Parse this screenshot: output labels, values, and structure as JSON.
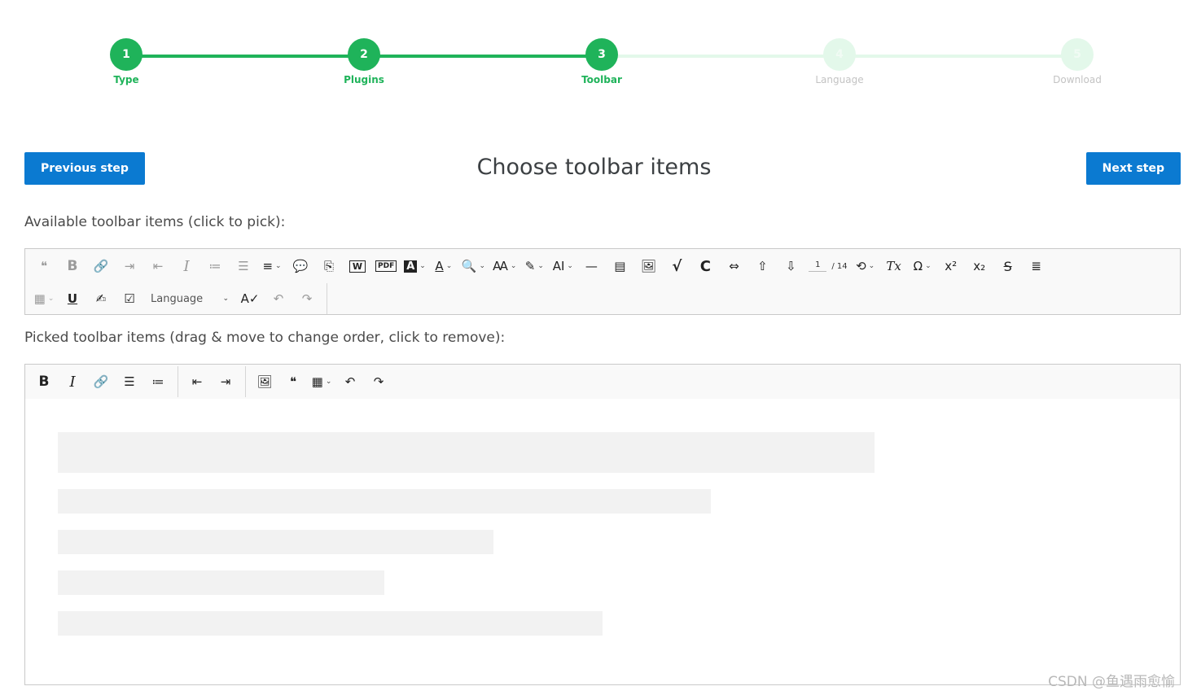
{
  "stepper": {
    "steps": [
      {
        "number": "1",
        "label": "Type",
        "state": "done"
      },
      {
        "number": "2",
        "label": "Plugins",
        "state": "done"
      },
      {
        "number": "3",
        "label": "Toolbar",
        "state": "active"
      },
      {
        "number": "4",
        "label": "Language",
        "state": "pending"
      },
      {
        "number": "5",
        "label": "Download",
        "state": "pending"
      }
    ],
    "colors": {
      "active": "#1fb35a",
      "pending": "#e3f8ea",
      "pending_text": "#c3c3c3"
    }
  },
  "header": {
    "prev_label": "Previous step",
    "title": "Choose toolbar items",
    "next_label": "Next step",
    "button_color": "#0b7ad1"
  },
  "available": {
    "label": "Available toolbar items (click to pick):",
    "items": [
      {
        "name": "block-quote",
        "glyph": "❝",
        "dis": true
      },
      {
        "name": "bold",
        "glyph": "B",
        "dis": true
      },
      {
        "name": "link",
        "glyph": "🔗",
        "dis": true
      },
      {
        "name": "indent",
        "glyph": "⇥",
        "dis": true
      },
      {
        "name": "outdent",
        "glyph": "⇤",
        "dis": true
      },
      {
        "name": "italic",
        "glyph": "I",
        "dis": true
      },
      {
        "name": "numbered-list",
        "glyph": "≔",
        "dis": true
      },
      {
        "name": "bulleted-list",
        "glyph": "☰",
        "dis": true
      },
      {
        "name": "alignment",
        "glyph": "≡",
        "dd": true
      },
      {
        "name": "comment",
        "glyph": "💬"
      },
      {
        "name": "export-html",
        "glyph": "⎘"
      },
      {
        "name": "export-word",
        "glyph": "W"
      },
      {
        "name": "export-pdf",
        "glyph": "PDF"
      },
      {
        "name": "font-background-color",
        "glyph": "A",
        "dd": true
      },
      {
        "name": "font-color",
        "glyph": "A",
        "dd": true
      },
      {
        "name": "find-replace",
        "glyph": "🔍",
        "dd": true
      },
      {
        "name": "font-family",
        "glyph": "Ꜳ",
        "dd": true
      },
      {
        "name": "highlight",
        "glyph": "✎",
        "dd": true
      },
      {
        "name": "font-size",
        "glyph": "AI",
        "dd": true
      },
      {
        "name": "horizontal-line",
        "glyph": "—"
      },
      {
        "name": "html-embed",
        "glyph": "▤"
      },
      {
        "name": "image",
        "glyph": "🖼"
      },
      {
        "name": "math",
        "glyph": "√"
      },
      {
        "name": "code",
        "glyph": "C"
      },
      {
        "name": "page-break",
        "glyph": "⇔"
      },
      {
        "name": "previous-page",
        "glyph": "⇧"
      },
      {
        "name": "next-page",
        "glyph": "⇩"
      },
      {
        "name": "history",
        "glyph": "⟲",
        "dd": true
      },
      {
        "name": "remove-format",
        "glyph": "Tx"
      },
      {
        "name": "special-characters",
        "glyph": "Ω",
        "dd": true
      },
      {
        "name": "superscript",
        "glyph": "x²"
      },
      {
        "name": "subscript",
        "glyph": "x₂"
      },
      {
        "name": "strikethrough",
        "glyph": "S"
      },
      {
        "name": "restricted-editing",
        "glyph": "≣"
      }
    ],
    "page_current": "1",
    "page_total": "/ 14",
    "row2": [
      {
        "name": "table",
        "glyph": "▦",
        "dd": true,
        "dis": true
      },
      {
        "name": "underline",
        "glyph": "U"
      },
      {
        "name": "text-part-language",
        "glyph": "✍"
      },
      {
        "name": "todo-list",
        "glyph": "☑"
      },
      {
        "name": "spell-check",
        "glyph": "A✓"
      },
      {
        "name": "undo",
        "glyph": "↶",
        "dis": true
      },
      {
        "name": "redo",
        "glyph": "↷",
        "dis": true
      }
    ],
    "language_label": "Language"
  },
  "picked": {
    "label": "Picked toolbar items (drag & move to change order, click to remove):",
    "group1": [
      {
        "name": "bold",
        "glyph": "B"
      },
      {
        "name": "italic",
        "glyph": "I"
      },
      {
        "name": "link",
        "glyph": "🔗"
      },
      {
        "name": "bulleted-list",
        "glyph": "☰"
      },
      {
        "name": "numbered-list",
        "glyph": "≔"
      }
    ],
    "group2": [
      {
        "name": "outdent",
        "glyph": "⇤"
      },
      {
        "name": "indent",
        "glyph": "⇥"
      }
    ],
    "group3": [
      {
        "name": "image",
        "glyph": "🖼"
      },
      {
        "name": "block-quote",
        "glyph": "❝"
      },
      {
        "name": "table",
        "glyph": "▦",
        "dd": true
      },
      {
        "name": "undo",
        "glyph": "↶"
      },
      {
        "name": "redo",
        "glyph": "↷"
      }
    ]
  },
  "watermark": "CSDN @鱼遇雨愈愉"
}
